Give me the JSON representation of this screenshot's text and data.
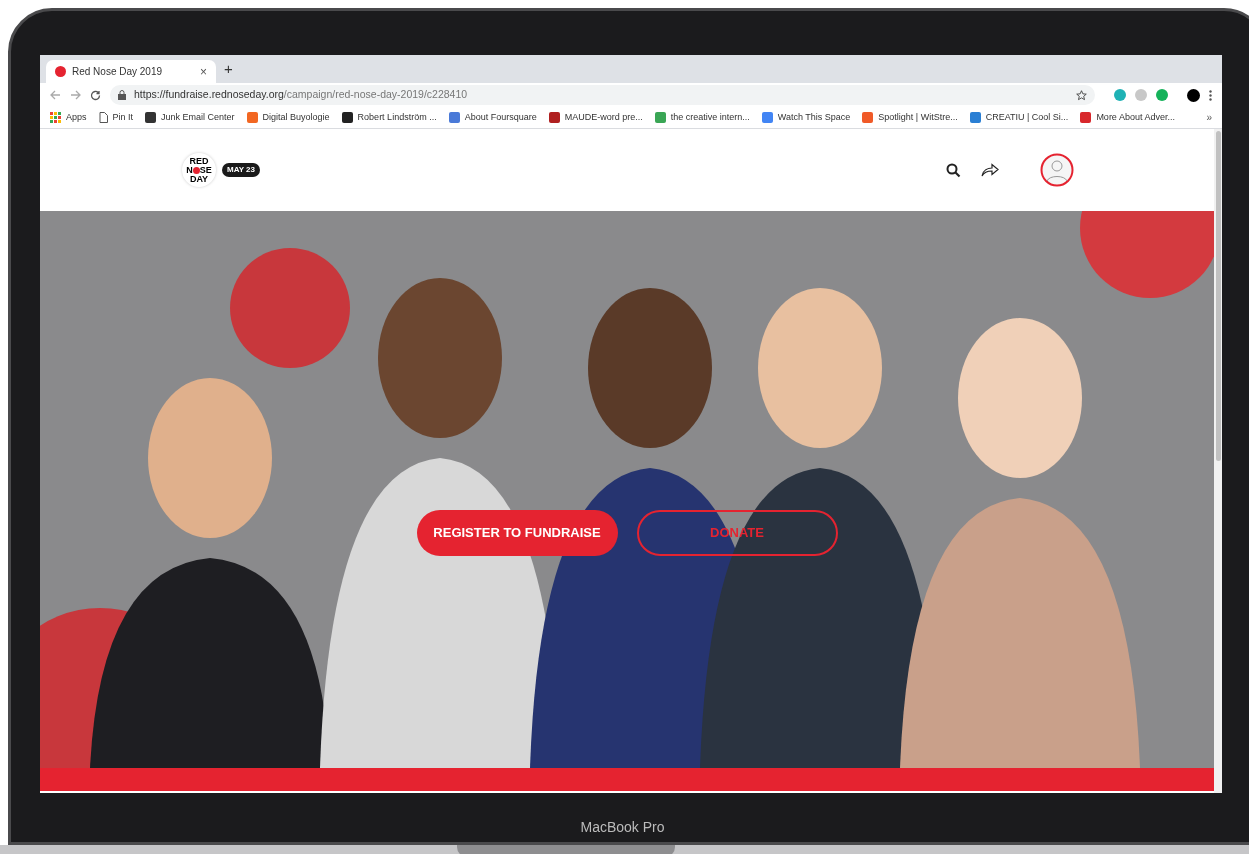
{
  "browser": {
    "tab": {
      "title": "Red Nose Day 2019",
      "close": "×",
      "new_tab": "+"
    },
    "address": {
      "host": "https://fundraise.rednoseday.org",
      "path": "/campaign/red-nose-day-2019/c228410"
    },
    "bookmarks": [
      {
        "kind": "apps",
        "label": "Apps"
      },
      {
        "kind": "page",
        "label": "Pin It"
      },
      {
        "kind": "site",
        "label": "Junk Email Center",
        "color": "#333333"
      },
      {
        "kind": "site",
        "label": "Digital Buyologie",
        "color": "#f26722"
      },
      {
        "kind": "site",
        "label": "Robert Lindström ...",
        "color": "#222222"
      },
      {
        "kind": "site",
        "label": "About Foursquare",
        "color": "#4a7ad8"
      },
      {
        "kind": "site",
        "label": "MAUDE-word pre...",
        "color": "#b02020"
      },
      {
        "kind": "site",
        "label": "the creative intern...",
        "color": "#3aa655"
      },
      {
        "kind": "site",
        "label": "Watch This Space",
        "color": "#4285f4"
      },
      {
        "kind": "site",
        "label": "Spotlight | WitStre...",
        "color": "#f05a28"
      },
      {
        "kind": "site",
        "label": "CREATIU | Cool Si...",
        "color": "#2a7fd4"
      },
      {
        "kind": "site",
        "label": "More About Adver...",
        "color": "#d8282c"
      }
    ],
    "bookmarks_overflow": "»"
  },
  "site": {
    "logo": {
      "line1": "RED",
      "line2_start": "N",
      "line2_end": "SE",
      "line3": "DAY"
    },
    "date_badge": "MAY 23",
    "hero": {
      "buttons": [
        {
          "label": "REGISTER TO FUNDRAISE",
          "kind": "filled"
        },
        {
          "label": "DONATE",
          "kind": "outline"
        }
      ]
    }
  },
  "device_label": "MacBook Pro"
}
